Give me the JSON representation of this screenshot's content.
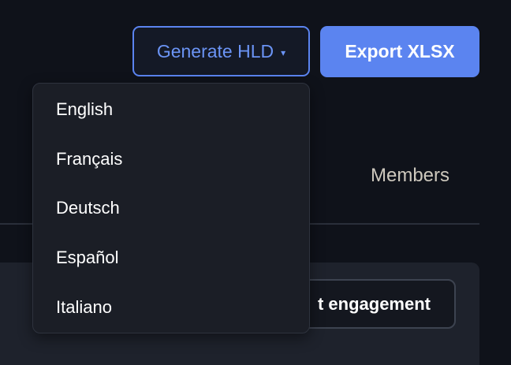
{
  "toolbar": {
    "generate_label": "Generate HLD",
    "export_label": "Export XLSX"
  },
  "tabs": {
    "members_label": "Members"
  },
  "content": {
    "engagement_label": "t engagement"
  },
  "language_menu": {
    "items": [
      {
        "label": "English"
      },
      {
        "label": "Français"
      },
      {
        "label": "Deutsch"
      },
      {
        "label": "Español"
      },
      {
        "label": "Italiano"
      }
    ]
  },
  "colors": {
    "accent": "#5b84f0",
    "background": "#0f121a",
    "menu_background": "#1b1e26"
  },
  "icons": {
    "caret": "caret-down-icon"
  }
}
